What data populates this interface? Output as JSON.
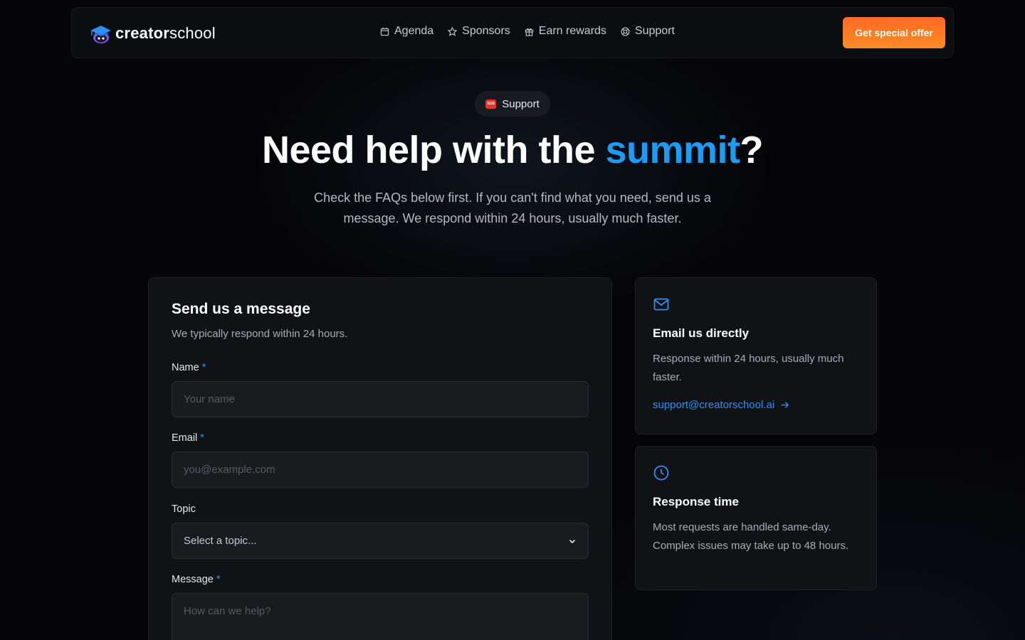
{
  "header": {
    "brand_bold": "creator",
    "brand_light": "school",
    "nav": [
      {
        "label": "Agenda",
        "icon": "calendar-icon"
      },
      {
        "label": "Sponsors",
        "icon": "star-icon"
      },
      {
        "label": "Earn rewards",
        "icon": "gift-icon"
      },
      {
        "label": "Support",
        "icon": "lifebuoy-icon"
      }
    ],
    "cta_label": "Get special offer"
  },
  "hero": {
    "badge_icon_text": "SOS",
    "badge_label": "Support",
    "title_pre": "Need help with the ",
    "title_accent": "summit",
    "title_post": "?",
    "subtitle": "Check the FAQs below first. If you can't find what you need, send us a message. We respond within 24 hours, usually much faster."
  },
  "form": {
    "title": "Send us a message",
    "subtitle": "We typically respond within 24 hours.",
    "name_label": "Name",
    "name_placeholder": "Your name",
    "email_label": "Email",
    "email_placeholder": "you@example.com",
    "topic_label": "Topic",
    "topic_value": "Select a topic...",
    "message_label": "Message",
    "message_placeholder": "How can we help?",
    "required_mark": "*"
  },
  "email_card": {
    "title": "Email us directly",
    "text": "Response within 24 hours, usually much faster.",
    "link": "support@creatorschool.ai"
  },
  "response_card": {
    "title": "Response time",
    "text": "Most requests are handled same-day. Complex issues may take up to 48 hours."
  },
  "colors": {
    "accent_blue": "#1e9bf5",
    "cta_orange": "#ff6a2b",
    "background": "#050507"
  }
}
